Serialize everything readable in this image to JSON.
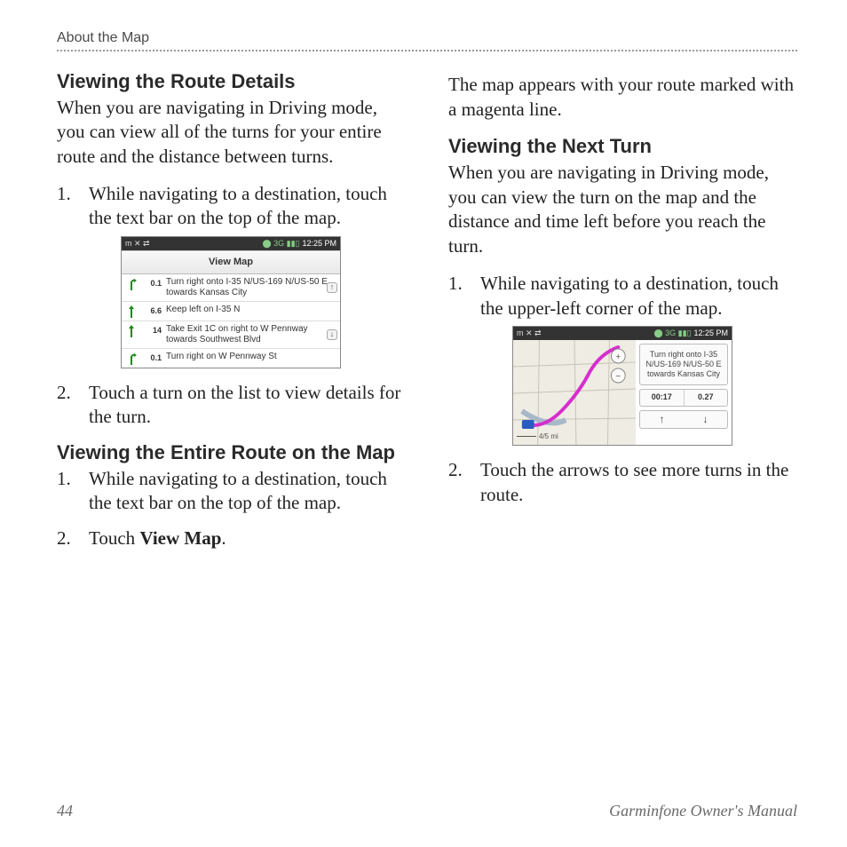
{
  "header": {
    "section_label": "About the Map"
  },
  "footer": {
    "page_number": "44",
    "manual_title": "Garminfone Owner's Manual"
  },
  "section1": {
    "heading": "Viewing the Route Details",
    "intro": "When you are navigating in Driving mode, you can view all of the turns for your entire route and the distance between turns.",
    "step1": "While navigating to a destination, touch the text bar on the top of the map.",
    "step2": "Touch a turn on the list to view details for the turn."
  },
  "turnlist_screenshot": {
    "status_time": "12:25 PM",
    "status_left_glyphs": "m ✕ ⇄",
    "status_signal_glyphs": "⬤ 3G ▮▮▯",
    "view_map_label": "View Map",
    "rows": [
      {
        "dist": "0.1",
        "text": "Turn right onto I-35 N/US-169 N/US-50 E towards Kansas City"
      },
      {
        "dist": "6.6",
        "text": "Keep left on I-35 N"
      },
      {
        "dist": "14",
        "text": "Take Exit 1C on right to W Pennway towards Southwest Blvd"
      },
      {
        "dist": "0.1",
        "text": "Turn right on W Pennway St"
      }
    ]
  },
  "section2": {
    "heading": "Viewing the Entire Route on the Map",
    "step1": "While navigating to a destination, touch the text bar on the top of the map.",
    "step2_prefix": "Touch ",
    "step2_bold": "View Map",
    "step2_suffix": "."
  },
  "continuation_para": "The map appears with your route marked with a magenta line.",
  "section3": {
    "heading": "Viewing the Next Turn",
    "intro": "When you are navigating in Driving mode, you can view the turn on the map and the distance and time left before you reach the turn.",
    "step1": "While navigating to a destination, touch the upper-left corner of the map.",
    "step2": "Touch the arrows to see more turns in the route."
  },
  "nextturn_screenshot": {
    "status_time": "12:25 PM",
    "status_left_glyphs": "m ✕ ⇄",
    "status_signal_glyphs": "⬤ 3G ▮▮▯",
    "turn_text": "Turn right onto I-35 N/US-169 N/US-50 E towards Kansas City",
    "time_left": "00:17",
    "dist_left": "0.27",
    "scale_label": "4/5 mi",
    "up_arrow": "↑",
    "down_arrow": "↓"
  }
}
